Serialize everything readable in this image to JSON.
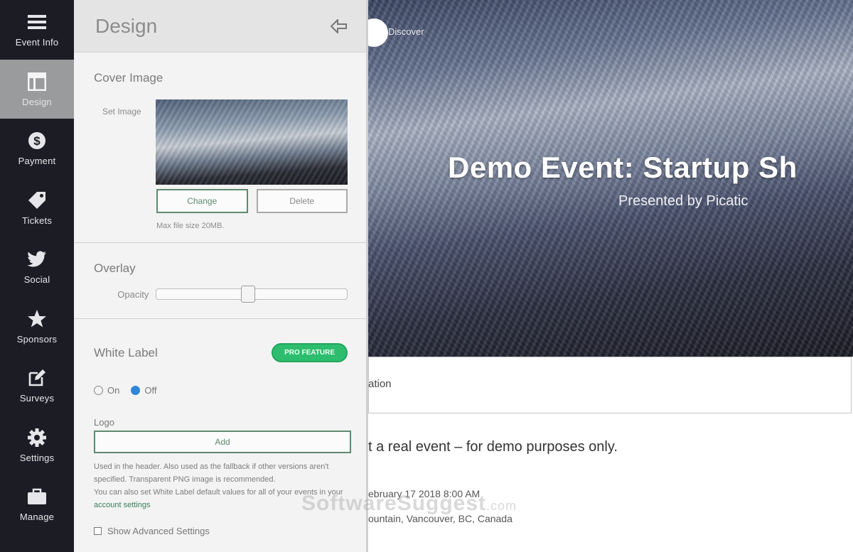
{
  "rail": {
    "items": [
      {
        "label": "Event Info",
        "icon": "list-icon",
        "active": false
      },
      {
        "label": "Design",
        "icon": "layout-icon",
        "active": true
      },
      {
        "label": "Payment",
        "icon": "dollar-icon",
        "active": false
      },
      {
        "label": "Tickets",
        "icon": "tag-icon",
        "active": false
      },
      {
        "label": "Social",
        "icon": "twitter-icon",
        "active": false
      },
      {
        "label": "Sponsors",
        "icon": "star-icon",
        "active": false
      },
      {
        "label": "Surveys",
        "icon": "edit-icon",
        "active": false
      },
      {
        "label": "Settings",
        "icon": "gear-icon",
        "active": false
      },
      {
        "label": "Manage",
        "icon": "briefcase-icon",
        "active": false
      }
    ]
  },
  "panel": {
    "title": "Design",
    "cover": {
      "heading": "Cover Image",
      "set_label": "Set Image",
      "change_label": "Change",
      "delete_label": "Delete",
      "max_size": "Max file size 20MB."
    },
    "overlay": {
      "heading": "Overlay",
      "opacity_label": "Opacity",
      "opacity_value": 0.48
    },
    "white_label": {
      "heading": "White Label",
      "badge": "PRO FEATURE",
      "on_label": "On",
      "off_label": "Off",
      "selected": "Off",
      "logo_label": "Logo",
      "add_label": "Add",
      "help_text": "Used in the header. Also used as the fallback if other versions aren't specified. Transparent PNG image is recommended.",
      "help_text_2": "You can also set White Label default values for all of your events in your",
      "help_link": "account settings",
      "advanced_label": "Show Advanced Settings"
    }
  },
  "preview": {
    "discover": "Discover",
    "title": "Demo Event: Startup Sh",
    "subtitle": "Presented by Picatic",
    "tab": "ation",
    "disclaimer": "t a real event – for demo purposes only.",
    "date": "ebruary 17 2018 8:00 AM",
    "location": "ountain, Vancouver, BC, Canada"
  },
  "watermark": {
    "main": "SoftwareSuggest",
    "suffix": ".com"
  },
  "colors": {
    "accent_green": "#2dbd6e",
    "button_green": "#5f8a70",
    "radio_blue": "#2f86d6",
    "rail_bg": "#1c1d24"
  }
}
